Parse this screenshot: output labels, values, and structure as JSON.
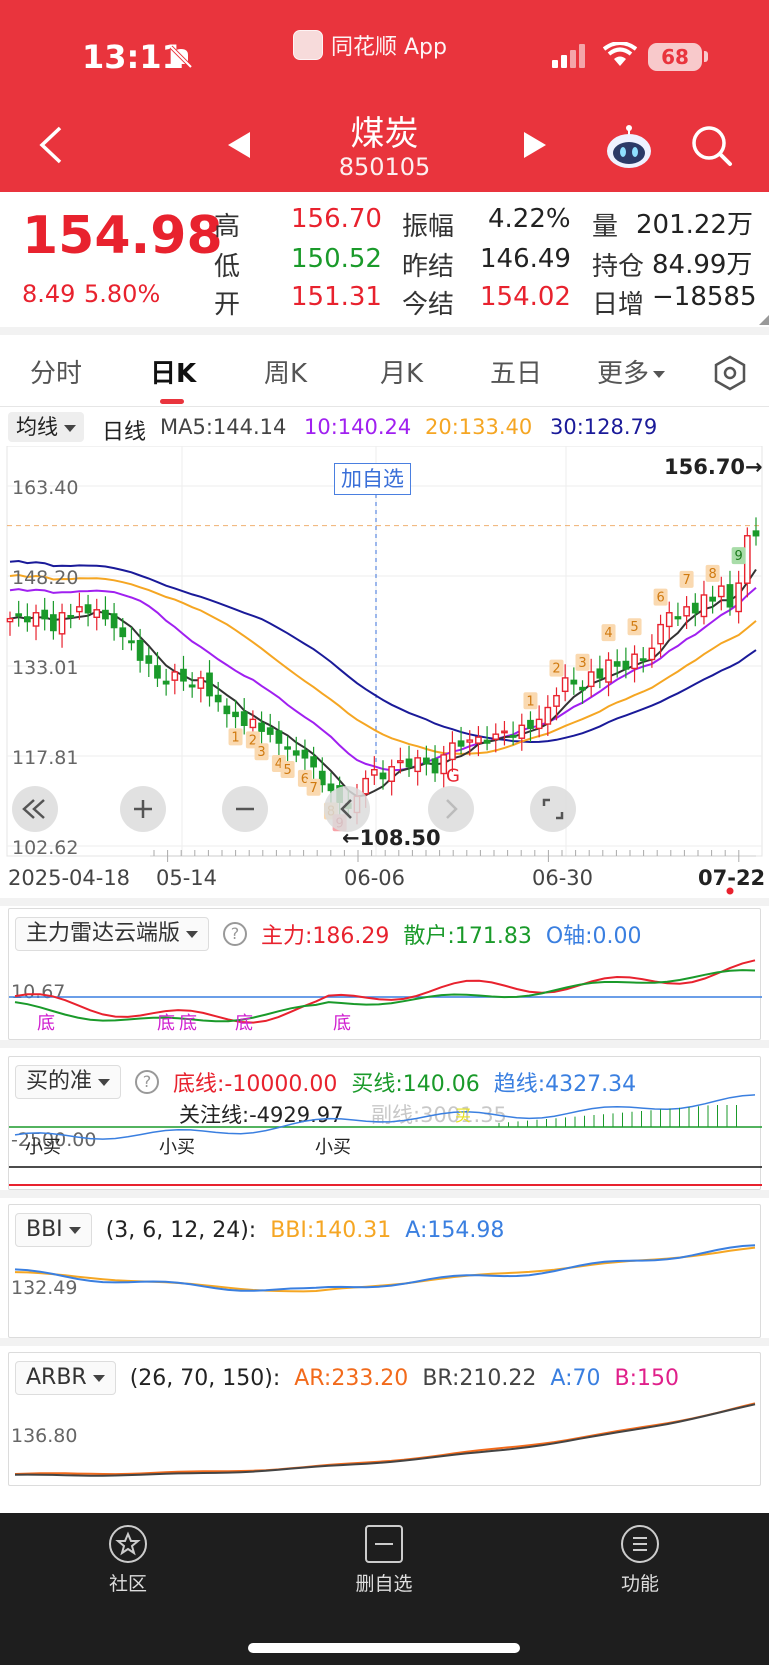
{
  "status": {
    "time": "13:11",
    "app_name": "同花顺 App",
    "battery": "68"
  },
  "header": {
    "title": "煤炭",
    "code": "850105"
  },
  "quote": {
    "price": "154.98",
    "change": "8.49",
    "change_pct": "5.80%",
    "fields": {
      "high_label": "高",
      "high": "156.70",
      "low_label": "低",
      "low": "150.52",
      "open_label": "开",
      "open": "151.31",
      "amp_label": "振幅",
      "amp": "4.22%",
      "prev_label": "昨结",
      "prev": "146.49",
      "settle_label": "今结",
      "settle": "154.02",
      "vol_label": "量",
      "vol": "201.22万",
      "oi_label": "持仓",
      "oi": "84.99万",
      "inc_label": "日增",
      "inc": "−18585"
    }
  },
  "tabs": {
    "t1": "分时",
    "t2": "日K",
    "t3": "周K",
    "t4": "月K",
    "t5": "五日",
    "t6": "更多",
    "active": "日K"
  },
  "ma_legend": {
    "select": "均线",
    "period": "日线",
    "ma5": "MA5:144.14",
    "ma10": "10:140.24",
    "ma20": "20:133.40",
    "ma30": "30:128.79",
    "colors": {
      "ma5": "#333333",
      "ma10": "#a020f0",
      "ma20": "#f5a623",
      "ma30": "#1a1a99"
    }
  },
  "chart": {
    "y_ticks": [
      "163.40",
      "148.20",
      "133.01",
      "117.81",
      "102.62"
    ],
    "high_marker": "156.70→",
    "low_marker": "←108.50",
    "add_watch": "加自选",
    "dates": [
      "2025-04-18",
      "05-14",
      "06-06",
      "06-30",
      "07-22"
    ],
    "g_mark": "G",
    "seq_low": [
      "1",
      "2",
      "3",
      "4",
      "5",
      "6",
      "7",
      "8",
      "9"
    ],
    "seq_high": [
      "1",
      "2",
      "3",
      "4",
      "5",
      "6",
      "7",
      "8",
      "9"
    ]
  },
  "chart_data": {
    "type": "candlestick",
    "title": "煤炭 850105 日K",
    "ylim": [
      102.62,
      163.4
    ],
    "y_ticks": [
      163.4,
      148.2,
      133.01,
      117.81,
      102.62
    ],
    "x_tick_labels": [
      "2025-04-18",
      "05-14",
      "06-06",
      "06-30",
      "07-22"
    ],
    "high": 156.7,
    "low": 108.5,
    "last": {
      "open": 151.31,
      "high": 156.7,
      "low": 150.52,
      "close": 154.98
    },
    "ma_latest": {
      "MA5": 144.14,
      "MA10": 140.24,
      "MA20": 133.4,
      "MA30": 128.79
    },
    "closes": [
      141,
      141.5,
      140.5,
      142,
      141,
      139,
      142,
      141.5,
      143,
      142,
      142.5,
      141,
      139.5,
      138,
      137,
      134,
      133.5,
      131,
      130,
      132,
      130.5,
      129.5,
      131,
      128,
      127,
      125,
      124.5,
      123,
      124,
      122,
      121.5,
      120,
      119,
      118,
      117.5,
      116,
      113,
      112,
      110,
      109,
      111,
      114,
      115.5,
      114,
      116,
      117,
      116,
      117.5,
      116.5,
      115,
      118,
      120,
      119.5,
      120.5,
      121,
      120,
      121.5,
      122,
      121,
      123,
      122.5,
      124,
      126,
      128,
      131,
      130,
      129,
      132,
      131,
      134,
      133,
      132.5,
      135,
      134,
      136,
      140,
      142,
      141,
      143,
      142,
      145,
      144,
      146.5,
      143,
      147,
      155,
      155
    ]
  },
  "ind1": {
    "name": "主力雷达云端版",
    "zhuli": "主力:186.29",
    "sanhu": "散户:171.83",
    "oaxis": "O轴:0.00",
    "tick": "10.67",
    "bottom": "底"
  },
  "ind2": {
    "name": "买的准",
    "dixian": "底线:-10000.00",
    "maixian": "买线:140.06",
    "quxian": "趋线:4327.34",
    "guanzhu": "关注线:-4929.97",
    "fuxian": "副线:3001.35",
    "tick": "-2500.00",
    "xiaomai": "小买",
    "mai": "买"
  },
  "ind3": {
    "name": "BBI",
    "params": "(3, 6, 12, 24):",
    "bbi": "BBI:140.31",
    "a": "A:154.98",
    "tick": "132.49"
  },
  "ind4": {
    "name": "ARBR",
    "params": "(26, 70, 150):",
    "ar": "AR:233.20",
    "br": "BR:210.22",
    "a": "A:70",
    "b": "B:150",
    "tick": "136.80"
  },
  "nav": {
    "community": "社区",
    "remove_watch": "删自选",
    "functions": "功能"
  }
}
